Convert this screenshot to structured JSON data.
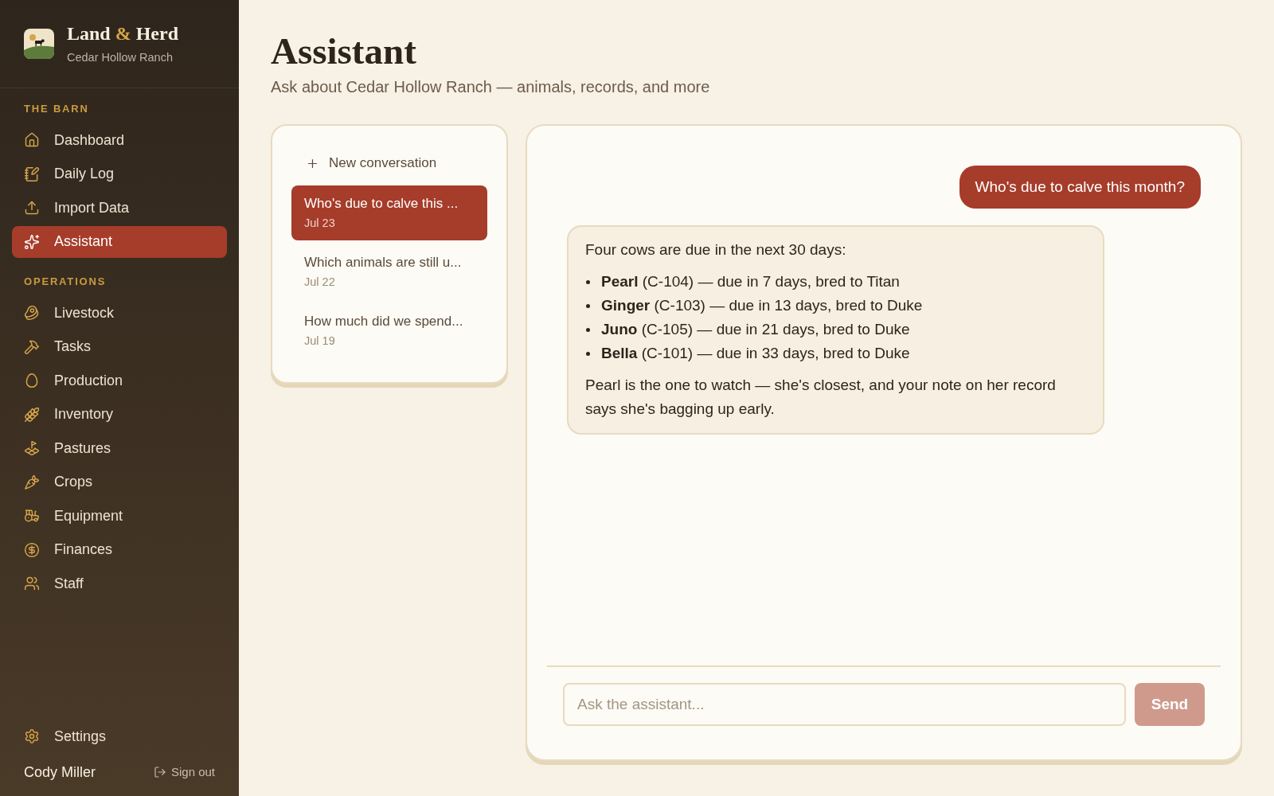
{
  "sidebar": {
    "brand": {
      "title": {
        "before": "Land",
        "accent": "&",
        "after": "Herd"
      },
      "subtitle": "Cedar Hollow Ranch"
    },
    "sections": [
      {
        "heading": "THE BARN",
        "items": [
          {
            "label": "Dashboard",
            "selected": false
          },
          {
            "label": "Daily Log",
            "selected": false
          },
          {
            "label": "Import Data",
            "selected": false
          },
          {
            "label": "Assistant",
            "selected": true
          }
        ]
      },
      {
        "heading": "OPERATIONS",
        "items": [
          {
            "label": "Livestock",
            "selected": false
          },
          {
            "label": "Tasks",
            "selected": false
          },
          {
            "label": "Production",
            "selected": false
          },
          {
            "label": "Inventory",
            "selected": false
          },
          {
            "label": "Pastures",
            "selected": false
          },
          {
            "label": "Crops",
            "selected": false
          },
          {
            "label": "Equipment",
            "selected": false
          },
          {
            "label": "Finances",
            "selected": false
          },
          {
            "label": "Staff",
            "selected": false
          }
        ]
      }
    ],
    "footer": {
      "items": [
        {
          "label": "Settings",
          "selected": false
        }
      ],
      "user": {
        "name": "Cody Miller"
      },
      "sign_out": "Sign out"
    }
  },
  "page": {
    "title": "Assistant",
    "subtitle": "Ask about Cedar Hollow Ranch — animals, records, and more"
  },
  "conversations": {
    "new_button": "New conversation",
    "items": [
      {
        "title": "Who's due to calve this ...",
        "date": "Jul 23",
        "selected": true
      },
      {
        "title": "Which animals are still u...",
        "date": "Jul 22",
        "selected": false
      },
      {
        "title": "How much did we spend...",
        "date": "Jul 19",
        "selected": false
      }
    ]
  },
  "chat": {
    "messages": [
      {
        "kind": "user",
        "text": "Who's due to calve this month?"
      },
      {
        "kind": "assistant",
        "blocks": [
          {
            "kind": "paragraph",
            "text": "Four cows are due in the next 30 days:"
          },
          {
            "kind": "bullets",
            "items": [
              "**Pearl** (C-104) — due in 7 days, bred to Titan",
              "**Ginger** (C-103) — due in 13 days, bred to Duke",
              "**Juno** (C-105) — due in 21 days, bred to Duke",
              "**Bella** (C-101) — due in 33 days, bred to Duke"
            ]
          },
          {
            "kind": "paragraph",
            "text": "Pearl is the one to watch — she's closest, and your note on her record says she's bagging up early."
          }
        ]
      }
    ],
    "composer": {
      "placeholder": "Ask the assistant...",
      "send": {
        "label": "Send",
        "disabled": true
      }
    }
  }
}
